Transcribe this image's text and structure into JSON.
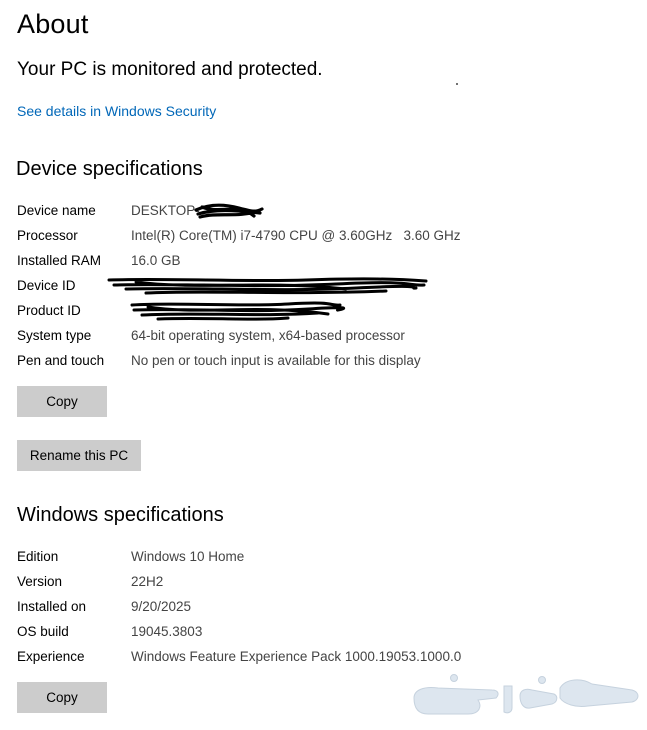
{
  "page": {
    "title": "About",
    "protection_status": "Your PC is monitored and protected.",
    "security_link": "See details in Windows Security"
  },
  "device_specs": {
    "heading": "Device specifications",
    "rows": [
      {
        "label": "Device name",
        "value": "DESKTOP-"
      },
      {
        "label": "Processor",
        "value": "Intel(R) Core(TM) i7-4790 CPU @ 3.60GHz   3.60 GHz"
      },
      {
        "label": "Installed RAM",
        "value": "16.0 GB"
      },
      {
        "label": "Device ID",
        "value": ""
      },
      {
        "label": "Product ID",
        "value": ""
      },
      {
        "label": "System type",
        "value": "64-bit operating system, x64-based processor"
      },
      {
        "label": "Pen and touch",
        "value": "No pen or touch input is available for this display"
      }
    ],
    "copy_label": "Copy",
    "rename_label": "Rename this PC"
  },
  "windows_specs": {
    "heading": "Windows specifications",
    "rows": [
      {
        "label": "Edition",
        "value": "Windows 10 Home"
      },
      {
        "label": "Version",
        "value": "22H2"
      },
      {
        "label": "Installed on",
        "value": "9/20/2025"
      },
      {
        "label": "OS build",
        "value": "19045.3803"
      },
      {
        "label": "Experience",
        "value": "Windows Feature Experience Pack 1000.19053.1000.0"
      }
    ],
    "copy_label": "Copy"
  },
  "watermark": {
    "text": "حراج"
  }
}
